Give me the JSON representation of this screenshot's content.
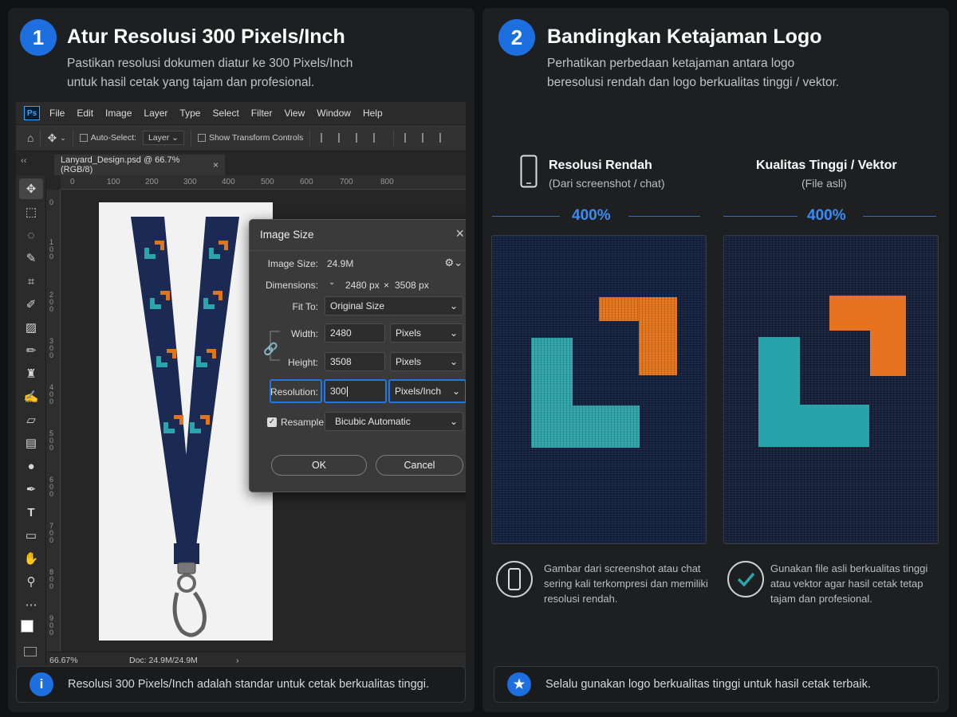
{
  "step1": {
    "number": "1",
    "title": "Atur Resolusi 300 Pixels/Inch",
    "desc_line1": "Pastikan resolusi dokumen diatur ke 300 Pixels/Inch",
    "desc_line2": "untuk hasil cetak yang tajam dan profesional."
  },
  "photoshop": {
    "logo": "Ps",
    "menu": [
      "File",
      "Edit",
      "Image",
      "Layer",
      "Type",
      "Select",
      "Filter",
      "View",
      "Window",
      "Help"
    ],
    "options": {
      "auto_select": "Auto-Select:",
      "layer": "Layer",
      "show_transform": "Show Transform Controls"
    },
    "tab_label": "Lanyard_Design.psd @ 66.7% (RGB/8)",
    "ruler_h": [
      "0",
      "100",
      "200",
      "300",
      "400",
      "500",
      "600",
      "700",
      "800"
    ],
    "ruler_v": [
      "0",
      "100",
      "200",
      "300",
      "400",
      "500",
      "600",
      "700",
      "800",
      "900"
    ],
    "status_zoom": "66.67%",
    "status_doc": "Doc: 24.9M/24.9M"
  },
  "dialog": {
    "title": "Image Size",
    "image_size_label": "Image Size:",
    "image_size_value": "24.9M",
    "dimensions_label": "Dimensions:",
    "dimensions_w": "2480 px",
    "dimensions_x": "×",
    "dimensions_h": "3508 px",
    "fit_to_label": "Fit To:",
    "fit_to_value": "Original Size",
    "width_label": "Width:",
    "width_value": "2480",
    "width_unit": "Pixels",
    "height_label": "Height:",
    "height_value": "3508",
    "height_unit": "Pixels",
    "resolution_label": "Resolution:",
    "resolution_value": "300",
    "resolution_unit": "Pixels/Inch",
    "resample_label": "Resample:",
    "resample_value": "Bicubic Automatic",
    "ok": "OK",
    "cancel": "Cancel"
  },
  "note1": {
    "icon": "i",
    "text": "Resolusi 300 Pixels/Inch adalah standar untuk cetak berkualitas tinggi."
  },
  "step2": {
    "number": "2",
    "title": "Bandingkan Ketajaman Logo",
    "desc_line1": "Perhatikan perbedaan ketajaman antara logo",
    "desc_line2": "beresolusi rendah dan logo berkualitas tinggi / vektor."
  },
  "compare": {
    "low": {
      "title": "Resolusi Rendah",
      "sub": "(Dari screenshot / chat)",
      "zoom": "400%",
      "cap1": "Gambar dari screenshot atau chat",
      "cap2": "sering kali terkompresi dan memiliki",
      "cap3": "resolusi rendah."
    },
    "high": {
      "title": "Kualitas Tinggi / Vektor",
      "sub": "(File asli)",
      "zoom": "400%",
      "cap1": "Gunakan file asli berkualitas tinggi",
      "cap2": "atau vektor agar hasil cetak tetap",
      "cap3": "tajam dan profesional."
    }
  },
  "note2": {
    "icon": "★",
    "text": "Selalu gunakan logo berkualitas tinggi untuk hasil cetak terbaik."
  },
  "colors": {
    "accent_blue": "#1d6fe0",
    "lanyard_navy": "#16223d",
    "logo_teal": "#2aa5ab",
    "logo_orange": "#e0751f"
  }
}
